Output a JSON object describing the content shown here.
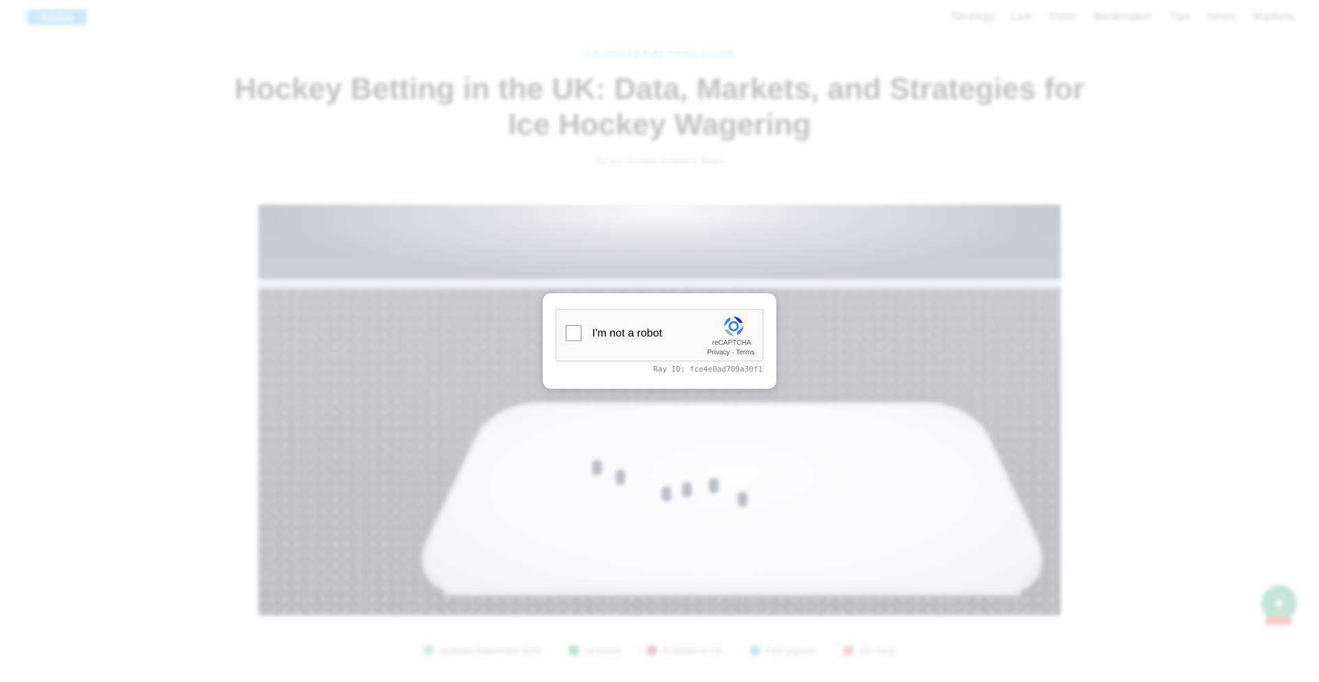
{
  "site": {
    "logo_text": "Hockey",
    "nav": [
      "Strategy",
      "Live",
      "Odds",
      "Bookmaker",
      "Tips",
      "News",
      "Markets"
    ]
  },
  "article": {
    "category": "ICE HOCKEY BETTING GUIDE",
    "title": "Hockey Betting in the UK: Data, Markets, and Strategies for Ice Hockey Wagering",
    "byline": "By Ice Hockey Analytics Team"
  },
  "meta_row": [
    {
      "icon": "calendar-icon",
      "label": "Updated September 2025",
      "color": "#6fbf8f"
    },
    {
      "icon": "license-icon",
      "label": "Licensed",
      "color": "#2e9d5e"
    },
    {
      "icon": "flag-icon",
      "label": "Available in UK",
      "color": "#c44a5a"
    },
    {
      "icon": "check-icon",
      "label": "Fast payouts",
      "color": "#5aa6c4"
    },
    {
      "icon": "age-icon",
      "label": "18+ Only",
      "color": "#e06a6a"
    }
  ],
  "chat": {
    "icon": "chat-icon",
    "badge_color": "#e14b4b",
    "color": "#3fae7a"
  },
  "captcha": {
    "label": "I'm not a robot",
    "brand": "reCAPTCHA",
    "privacy": "Privacy",
    "separator": " · ",
    "terms": "Terms",
    "ray_id": "Ray ID: fce4e0ad709a30f1"
  }
}
